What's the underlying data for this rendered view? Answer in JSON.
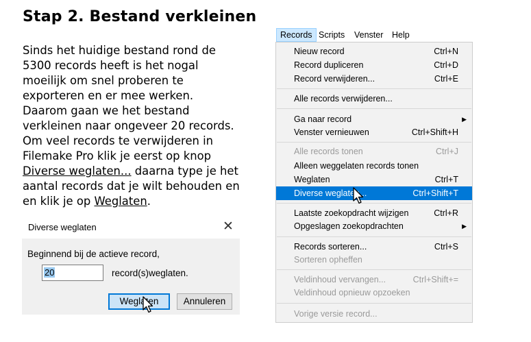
{
  "heading": "Stap 2. Bestand verkleinen",
  "paragraph": {
    "lines": [
      "Sinds het huidige bestand rond de",
      "5300 records heeft is het nogal",
      "moeilijk om snel proberen te",
      "exporteren en er mee werken.",
      "Daarom gaan we het bestand",
      "verkleinen naar ongeveer 20 records.",
      "Om veel records te verwijderen in",
      "Filemake Pro klik je eerst op knop"
    ],
    "link1": "Diverse weglaten...",
    "after_link1": " daarna type je het",
    "line10": "aantal records dat je wilt behouden en",
    "before_link2": "en klik je op ",
    "link2": "Weglaten",
    "after_link2": "."
  },
  "dialog": {
    "title": "Diverse weglaten",
    "close": "✕",
    "message": "Beginnend bij de actieve record,",
    "input_value": "20",
    "suffix": "record(s)weglaten.",
    "ok_label": "Weglaten",
    "cancel_label": "Annuleren"
  },
  "menubar": {
    "items": [
      "Records",
      "Scripts",
      "Venster",
      "Help"
    ]
  },
  "menu": {
    "items": [
      {
        "label": "Nieuw record",
        "shortcut": "Ctrl+N"
      },
      {
        "label": "Record dupliceren",
        "shortcut": "Ctrl+D"
      },
      {
        "label": "Record verwijderen...",
        "shortcut": "Ctrl+E"
      },
      {
        "label": "Alle records verwijderen...",
        "shortcut": ""
      },
      {
        "label": "Ga naar record",
        "shortcut": ""
      },
      {
        "label": "Venster vernieuwen",
        "shortcut": "Ctrl+Shift+H"
      },
      {
        "label": "Alle records tonen",
        "shortcut": "Ctrl+J"
      },
      {
        "label": "Alleen weggelaten records tonen",
        "shortcut": ""
      },
      {
        "label": "Weglaten",
        "shortcut": "Ctrl+T"
      },
      {
        "label": "Diverse weglaten...",
        "shortcut": "Ctrl+Shift+T"
      },
      {
        "label": "Laatste zoekopdracht wijzigen",
        "shortcut": "Ctrl+R"
      },
      {
        "label": "Opgeslagen zoekopdrachten",
        "shortcut": ""
      },
      {
        "label": "Records sorteren...",
        "shortcut": "Ctrl+S"
      },
      {
        "label": "Sorteren opheffen",
        "shortcut": ""
      },
      {
        "label": "Veldinhoud vervangen...",
        "shortcut": "Ctrl+Shift+="
      },
      {
        "label": "Veldinhoud opnieuw opzoeken",
        "shortcut": ""
      },
      {
        "label": "Vorige versie record...",
        "shortcut": ""
      }
    ]
  },
  "colors": {
    "highlight": "#0078d7",
    "menu_bg": "#f2f2f2",
    "disabled": "#9a9a9a"
  }
}
